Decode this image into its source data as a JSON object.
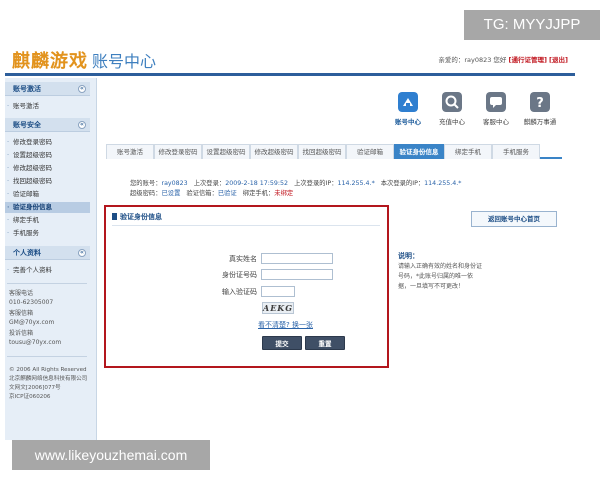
{
  "overlay": {
    "top_tag": "TG: MYYJJPP",
    "bottom_tag": "www.likeyouzhemai.com"
  },
  "header": {
    "logo_text": "麒麟游戏",
    "title": "账号中心",
    "welcome_prefix": "亲爱的：ray0823 您好",
    "link_pass": "[通行证管理]",
    "link_logout": "[退出]"
  },
  "sidebar": {
    "section1": {
      "title": "账号激活",
      "items": [
        "账号激活"
      ]
    },
    "section2": {
      "title": "账号安全",
      "items": [
        "修改登录密码",
        "设置超级密码",
        "修改超级密码",
        "找回超级密码",
        "验证邮箱",
        "验证身份信息",
        "绑定手机",
        "手机服务"
      ],
      "active_index": 5
    },
    "section3": {
      "title": "个人资料",
      "items": [
        "完善个人资料"
      ]
    },
    "service": {
      "hotline_label": "客服电话",
      "hotline_value": "010-62305007",
      "mail_label": "客服信箱",
      "mail_value": "GM@70yx.com",
      "complaint_label": "投诉信箱",
      "complaint_value": "tousu@70yx.com"
    },
    "footer": {
      "line1": "© 2006 All Rights Reserved",
      "line2": "北京麒麟网络信息科技有限公司",
      "line3": "文网文[2006]077号",
      "line4": "京ICP证060206"
    }
  },
  "icons": [
    {
      "label": "账号中心",
      "icon": "account-icon",
      "color": "#2f7fd0"
    },
    {
      "label": "充值中心",
      "icon": "recharge-icon",
      "color": "#6b7787"
    },
    {
      "label": "客服中心",
      "icon": "support-icon",
      "color": "#6b7787"
    },
    {
      "label": "麒麟万事通",
      "icon": "help-icon",
      "color": "#6b7787"
    }
  ],
  "tabs": [
    "账号激活",
    "修改登录密码",
    "设置超级密码",
    "修改超级密码",
    "找回超级密码",
    "验证邮箱",
    "验证身份信息",
    "绑定手机",
    "手机服务"
  ],
  "active_tab": 6,
  "account_info": {
    "line1_label_account": "您的账号：",
    "account": "ray0823",
    "line1_last_login_label": "上次登录：",
    "last_login": "2009-2-18 17:59:52",
    "line1_last_ip_label": "上次登录的IP：",
    "last_ip": "114.255.4.*",
    "line1_this_ip_label": "本次登录的IP：",
    "this_ip": "114.255.4.*",
    "line2_super_label": "超级密码：",
    "super_status": "已设置",
    "line2_email_label": "验证信箱：",
    "email_status": "已验证",
    "line2_phone_label": "绑定手机：",
    "phone_status": "未绑定"
  },
  "form": {
    "title": "验证身份信息",
    "name_label": "真实姓名",
    "id_label": "身份证号码",
    "code_label": "输入验证码",
    "name_value": "",
    "id_value": "",
    "code_value": "",
    "captcha_text": "AEKG",
    "refresh_text": "看不清楚? 换一张",
    "submit_label": "提交",
    "reset_label": "重置"
  },
  "right": {
    "back_label": "返回账号中心首页",
    "note_title": "说明：",
    "note_text": "请输入正确有效的姓名和身份证号码，*此账号归属的唯一依据，一旦填写不可更改！"
  },
  "colors": {
    "accent": "#3a84c7",
    "highlight": "#b3161d",
    "button": "#3f4f66"
  }
}
